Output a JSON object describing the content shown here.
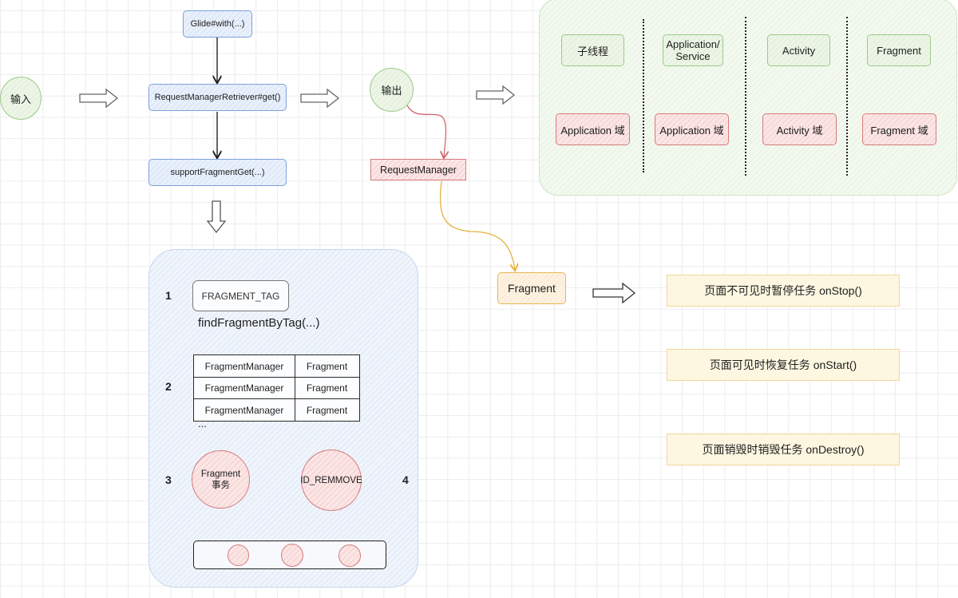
{
  "input_node": {
    "label": "输入"
  },
  "output_node": {
    "label": "输出"
  },
  "flow": {
    "glide_with": "Glide#with(...)",
    "retriever_get": "RequestManagerRetriever#get()",
    "support_fragment_get": "supportFragmentGet(...)"
  },
  "request_manager": {
    "label": "RequestManager"
  },
  "fragment_node": {
    "label": "Fragment"
  },
  "scopes": {
    "columns": [
      {
        "context": "子线程",
        "domain": "Application 域"
      },
      {
        "context": "Application/\nService",
        "domain": "Application 域"
      },
      {
        "context": "Activity",
        "domain": "Activity 域"
      },
      {
        "context": "Fragment",
        "domain": "Fragment 域"
      }
    ]
  },
  "lifecycle_notes": [
    "页面不可见时暂停任务 onStop()",
    "页面可见时恢复任务 onStart()",
    "页面销毁时销毁任务 onDestroy()"
  ],
  "steps": {
    "step1": {
      "number": "1",
      "tag_label": "FRAGMENT_TAG",
      "method": "findFragmentByTag(...)"
    },
    "step2": {
      "number": "2",
      "rows": [
        {
          "key": "FragmentManager",
          "value": "Fragment"
        },
        {
          "key": "FragmentManager",
          "value": "Fragment"
        },
        {
          "key": "FragmentManager",
          "value": "Fragment"
        }
      ],
      "ellipsis": "..."
    },
    "step3": {
      "number": "3",
      "label_line1": "Fragment",
      "label_line2": "事务"
    },
    "step4": {
      "number": "4",
      "label": "ID_REMMOVE"
    }
  }
}
